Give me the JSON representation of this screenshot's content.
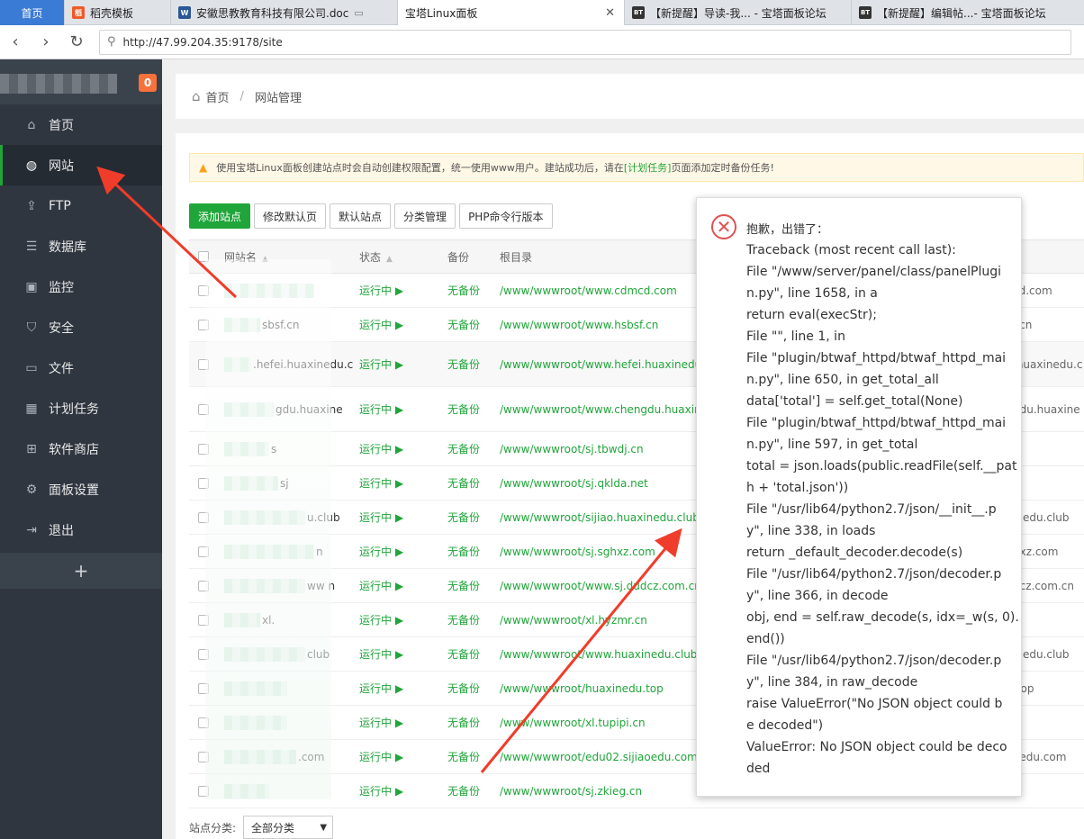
{
  "browser": {
    "tabs": [
      {
        "label": "首页"
      },
      {
        "label": "稻壳模板"
      },
      {
        "label": "安徽思教教育科技有限公司.doc"
      },
      {
        "label": "宝塔Linux面板"
      },
      {
        "label": "【新提醒】导读-我... - 宝塔面板论坛"
      },
      {
        "label": "【新提醒】编辑帖...- 宝塔面板论坛"
      }
    ],
    "url": "http://47.99.204.35:9178/site"
  },
  "sidebar": {
    "badge": "0",
    "items": [
      {
        "label": "首页",
        "icon": "home-icon"
      },
      {
        "label": "网站",
        "icon": "globe-icon"
      },
      {
        "label": "FTP",
        "icon": "ftp-icon"
      },
      {
        "label": "数据库",
        "icon": "database-icon"
      },
      {
        "label": "监控",
        "icon": "monitor-icon"
      },
      {
        "label": "安全",
        "icon": "shield-icon"
      },
      {
        "label": "文件",
        "icon": "folder-icon"
      },
      {
        "label": "计划任务",
        "icon": "calendar-icon"
      },
      {
        "label": "软件商店",
        "icon": "grid-icon"
      },
      {
        "label": "面板设置",
        "icon": "gear-icon"
      },
      {
        "label": "退出",
        "icon": "logout-icon"
      }
    ],
    "add": "+"
  },
  "breadcrumb": {
    "home": "首页",
    "sep": "/",
    "current": "网站管理"
  },
  "alert": {
    "text_before": "使用宝塔Linux面板创建站点时会自动创建权限配置，统一使用www用户。建站成功后，请在",
    "link": "[计划任务]",
    "text_after": "页面添加定时备份任务!"
  },
  "toolbar": {
    "add_site": "添加站点",
    "edit_default_page": "修改默认页",
    "default_site": "默认站点",
    "category_manage": "分类管理",
    "php_cli": "PHP命令行版本"
  },
  "table": {
    "headers": {
      "name": "网站名",
      "status": "状态",
      "backup": "备份",
      "root": "根目录"
    },
    "rows": [
      {
        "name": "",
        "status": "运行中 ▶",
        "backup": "无备份",
        "root": "/www/wwwroot/www.cdmcd.com",
        "right": "cd.com"
      },
      {
        "name": "sbsf.cn",
        "status": "运行中 ▶",
        "backup": "无备份",
        "root": "/www/wwwroot/www.hsbsf.cn",
        "right": "f.cn"
      },
      {
        "name": ".hefei.huaxinedu.c",
        "status": "运行中 ▶",
        "backup": "无备份",
        "root": "/www/wwwroot/www.hefei.huaxinedu",
        "right": ".huaxinedu.c"
      },
      {
        "name": "gdu.huaxine",
        "status": "运行中 ▶",
        "backup": "无备份",
        "root": "/www/wwwroot/www.chengdu.huaxin",
        "right": "gdu.huaxine"
      },
      {
        "name": "s",
        "status": "运行中 ▶",
        "backup": "无备份",
        "root": "/www/wwwroot/sj.tbwdj.cn",
        "right": ""
      },
      {
        "name": "sj",
        "status": "运行中 ▶",
        "backup": "无备份",
        "root": "/www/wwwroot/sj.qklda.net",
        "right": "t"
      },
      {
        "name": "u.club",
        "status": "运行中 ▶",
        "backup": "无备份",
        "root": "/www/wwwroot/sijiao.huaxinedu.club",
        "right": "inedu.club"
      },
      {
        "name": "n",
        "status": "运行中 ▶",
        "backup": "无备份",
        "root": "/www/wwwroot/sj.sghxz.com",
        "right": "hxz.com"
      },
      {
        "name": "ww                n",
        "status": "运行中 ▶",
        "backup": "无备份",
        "root": "/www/wwwroot/www.sj.dudcz.com.cn",
        "right": "dcz.com.cn"
      },
      {
        "name": "xl.",
        "status": "运行中 ▶",
        "backup": "无备份",
        "root": "/www/wwwroot/xl.hyzmr.cn",
        "right": "n"
      },
      {
        "name": "club",
        "status": "运行中 ▶",
        "backup": "无备份",
        "root": "/www/wwwroot/www.huaxinedu.club",
        "right": "inedu.club"
      },
      {
        "name": "",
        "status": "运行中 ▶",
        "backup": "无备份",
        "root": "/www/wwwroot/huaxinedu.top",
        "right": ".top"
      },
      {
        "name": "",
        "status": "运行中 ▶",
        "backup": "无备份",
        "root": "/www/wwwroot/xl.tupipi.cn",
        "right": "n"
      },
      {
        "name": ".com",
        "status": "运行中 ▶",
        "backup": "无备份",
        "root": "/www/wwwroot/edu02.sijiaoedu.com",
        "right": "oedu.com"
      },
      {
        "name": "",
        "status": "运行中 ▶",
        "backup": "无备份",
        "root": "/www/wwwroot/sj.zkieg.cn",
        "right": ""
      }
    ]
  },
  "footer": {
    "category_label": "站点分类:",
    "category_value": "全部分类"
  },
  "error": {
    "title": "抱歉，出错了：",
    "lines": [
      "Traceback (most recent call last):",
      "File \"/www/server/panel/class/panelPlugi",
      "n.py\", line 1658, in a",
      "return eval(execStr);",
      "File \"\", line 1, in",
      "File \"plugin/btwaf_httpd/btwaf_httpd_mai",
      "n.py\", line 650, in get_total_all",
      "data['total'] = self.get_total(None)",
      "File \"plugin/btwaf_httpd/btwaf_httpd_mai",
      "n.py\", line 597, in get_total",
      "total = json.loads(public.readFile(self.__pat",
      "h + 'total.json'))",
      "File \"/usr/lib64/python2.7/json/__init__.p",
      "y\", line 338, in loads",
      "return _default_decoder.decode(s)",
      "File \"/usr/lib64/python2.7/json/decoder.p",
      "y\", line 366, in decode",
      "obj, end = self.raw_decode(s, idx=_w(s, 0).",
      "end())",
      "File \"/usr/lib64/python2.7/json/decoder.p",
      "y\", line 384, in raw_decode",
      "raise ValueError(\"No JSON object could b",
      "e decoded\")",
      "ValueError: No JSON object could be deco",
      "ded"
    ]
  },
  "colors": {
    "green": "#20a53a",
    "sidebar": "#2f3640",
    "badge": "#f7713c",
    "error": "#e25050",
    "arrow": "#f03c2a"
  }
}
